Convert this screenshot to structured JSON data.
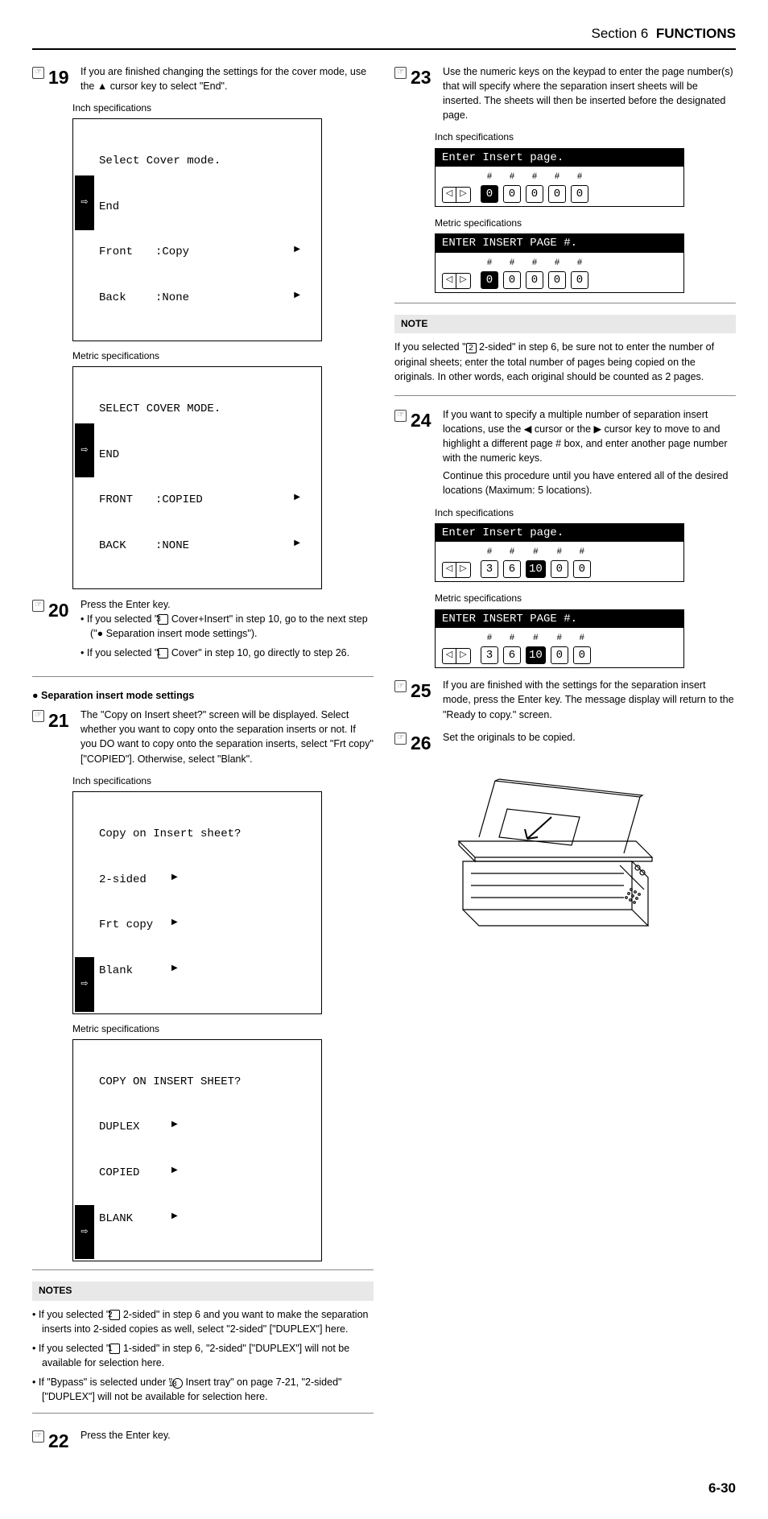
{
  "header": {
    "section": "Section 6",
    "title": "FUNCTIONS"
  },
  "page_number": "6-30",
  "steps": {
    "s19": {
      "num": "19",
      "text_a": "If you are finished changing the settings for the cover mode, use the ",
      "text_b": " cursor key to select \"End\".",
      "inch_label": "Inch specifications",
      "metric_label": "Metric specifications",
      "lcd_inch": {
        "title": "Select Cover mode.",
        "rows": [
          {
            "c1": "End",
            "c2": "",
            "arrow": ""
          },
          {
            "c1": "Front",
            "c2": ":Copy",
            "arrow": "▶"
          },
          {
            "c1": "Back",
            "c2": ":None",
            "arrow": "▶"
          }
        ],
        "sel": 0
      },
      "lcd_metric": {
        "title": "SELECT COVER MODE.",
        "rows": [
          {
            "c1": "END",
            "c2": "",
            "arrow": ""
          },
          {
            "c1": "FRONT",
            "c2": ":COPIED",
            "arrow": "▶"
          },
          {
            "c1": "BACK",
            "c2": ":NONE",
            "arrow": "▶"
          }
        ],
        "sel": 0
      }
    },
    "s20": {
      "num": "20",
      "line1": "Press the Enter key.",
      "bullets": [
        {
          "pre": "If you selected \"",
          "key": "3",
          "post": " Cover+Insert\" in step 10, go to the next step (\"● Separation insert mode settings\")."
        },
        {
          "pre": "If you selected \"",
          "key": "1",
          "post": " Cover\" in step 10, go directly to step 26."
        }
      ]
    },
    "sep_head": "Separation insert mode settings",
    "s21": {
      "num": "21",
      "text": "The \"Copy on Insert sheet?\" screen will be displayed. Select whether you want to copy onto the separation inserts or not. If you DO want to copy onto the separation inserts, select \"Frt copy\" [\"COPIED\"]. Otherwise, select \"Blank\".",
      "inch_label": "Inch specifications",
      "metric_label": "Metric specifications",
      "lcd_inch": {
        "title": "Copy on Insert sheet?",
        "rows": [
          {
            "c1": "2-sided",
            "arrow": "▶"
          },
          {
            "c1": "Frt copy",
            "arrow": "▶"
          },
          {
            "c1": "Blank",
            "arrow": "▶"
          }
        ],
        "sel": 2
      },
      "lcd_metric": {
        "title": "COPY ON INSERT SHEET?",
        "rows": [
          {
            "c1": "DUPLEX",
            "arrow": "▶"
          },
          {
            "c1": "COPIED",
            "arrow": "▶"
          },
          {
            "c1": "BLANK",
            "arrow": "▶"
          }
        ],
        "sel": 2
      }
    },
    "notes21": {
      "title": "NOTES",
      "items": [
        {
          "pre": "If you selected \"",
          "key": "2",
          "post": " 2-sided\" in step 6 and you want to make the separation inserts into 2-sided copies as well, select \"2-sided\" [\"DUPLEX\"] here."
        },
        {
          "pre": "If you selected \"",
          "key": "1",
          "post": " 1-sided\" in step 6, \"2-sided\" [\"DUPLEX\"] will not be available for selection here."
        },
        {
          "pre": "If \"Bypass\" is selected under \"",
          "circ": "18",
          "post": " Insert tray\" on page 7-21, \"2-sided\" [\"DUPLEX\"] will not be available for selection here."
        }
      ]
    },
    "s22": {
      "num": "22",
      "text": "Press the Enter key."
    },
    "s23": {
      "num": "23",
      "text": "Use the numeric keys on the keypad to enter the page number(s) that will specify where the separation insert sheets will be inserted. The sheets will then be inserted before the designated page.",
      "inch_label": "Inch specifications",
      "metric_label": "Metric specifications",
      "lcd_inch": {
        "title": "Enter Insert page.",
        "vals": [
          "0",
          "0",
          "0",
          "0",
          "0"
        ],
        "sel": 0
      },
      "lcd_metric": {
        "title": "ENTER INSERT PAGE #.",
        "vals": [
          "0",
          "0",
          "0",
          "0",
          "0"
        ],
        "sel": 0
      }
    },
    "note23": {
      "title": "NOTE",
      "text_a": "If you selected \"",
      "key": "2",
      "text_b": " 2-sided\" in step 6, be sure not to enter the number of original sheets; enter the total number of pages being copied on the originals. In other words, each original should be counted as 2 pages."
    },
    "s24": {
      "num": "24",
      "text_a": "If you want to specify a multiple number of separation insert locations, use the ",
      "text_b": " cursor or the ",
      "text_c": " cursor key to move to and highlight a different page # box, and enter another page number with the numeric keys.",
      "text_d": "Continue this procedure until you have entered all of the desired locations (Maximum: 5 locations).",
      "inch_label": "Inch specifications",
      "metric_label": "Metric specifications",
      "lcd_inch": {
        "title": "Enter Insert page.",
        "vals": [
          "3",
          "6",
          "10",
          "0",
          "0"
        ],
        "sel": 2
      },
      "lcd_metric": {
        "title": "ENTER INSERT PAGE #.",
        "vals": [
          "3",
          "6",
          "10",
          "0",
          "0"
        ],
        "sel": 2
      }
    },
    "s25": {
      "num": "25",
      "text": "If you are finished with the settings for the separation insert mode, press the Enter key. The message display will return to the \"Ready to copy.\" screen."
    },
    "s26": {
      "num": "26",
      "text": "Set the originals to be copied."
    }
  }
}
